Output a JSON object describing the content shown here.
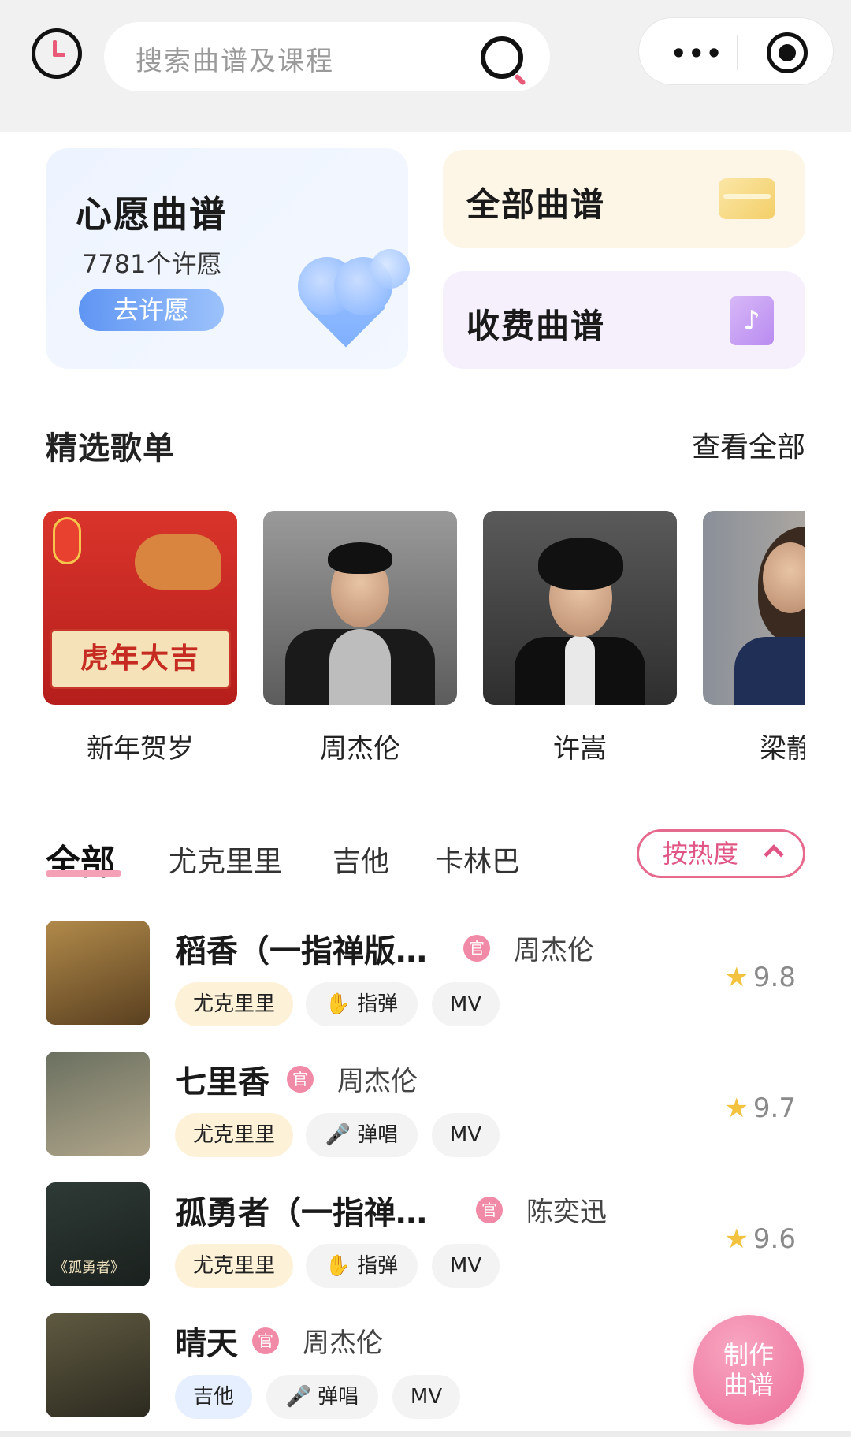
{
  "search": {
    "placeholder": "搜索曲谱及课程"
  },
  "capsule": {
    "more_glyph": "•••"
  },
  "wish_card": {
    "title": "心愿曲谱",
    "count": "7781个许愿",
    "button": "去许愿"
  },
  "quick_cards": [
    {
      "label": "全部曲谱",
      "icon": "folder-icon"
    },
    {
      "label": "收费曲谱",
      "icon": "music-note-icon"
    }
  ],
  "playlists": {
    "title": "精选歌单",
    "view_all": "查看全部",
    "items": [
      {
        "name": "新年贺岁",
        "banner": "虎年大吉"
      },
      {
        "name": "周杰伦"
      },
      {
        "name": "许嵩"
      },
      {
        "name": "梁静茹"
      }
    ]
  },
  "tabs": [
    {
      "label": "全部",
      "active": true
    },
    {
      "label": "尤克里里"
    },
    {
      "label": "吉他"
    },
    {
      "label": "卡林巴"
    }
  ],
  "sort": {
    "label": "按热度"
  },
  "songs": [
    {
      "title": "稻香（一指禅版…",
      "official": "官",
      "artist": "周杰伦",
      "instrument": "尤克里里",
      "style": "指弹",
      "mv": "MV",
      "rating": "9.8"
    },
    {
      "title": "七里香",
      "official": "官",
      "artist": "周杰伦",
      "instrument": "尤克里里",
      "style": "弹唱",
      "mv": "MV",
      "rating": "9.7"
    },
    {
      "title": "孤勇者（一指禅…",
      "official": "官",
      "artist": "陈奕迅",
      "instrument": "尤克里里",
      "style": "指弹",
      "mv": "MV",
      "rating": "9.6",
      "cover_text": "《孤勇者》"
    },
    {
      "title": "晴天",
      "official": "官",
      "artist": "周杰伦",
      "instrument": "吉他",
      "style": "弹唱",
      "mv": "MV"
    }
  ],
  "fab": {
    "line1": "制作",
    "line2": "曲谱"
  }
}
